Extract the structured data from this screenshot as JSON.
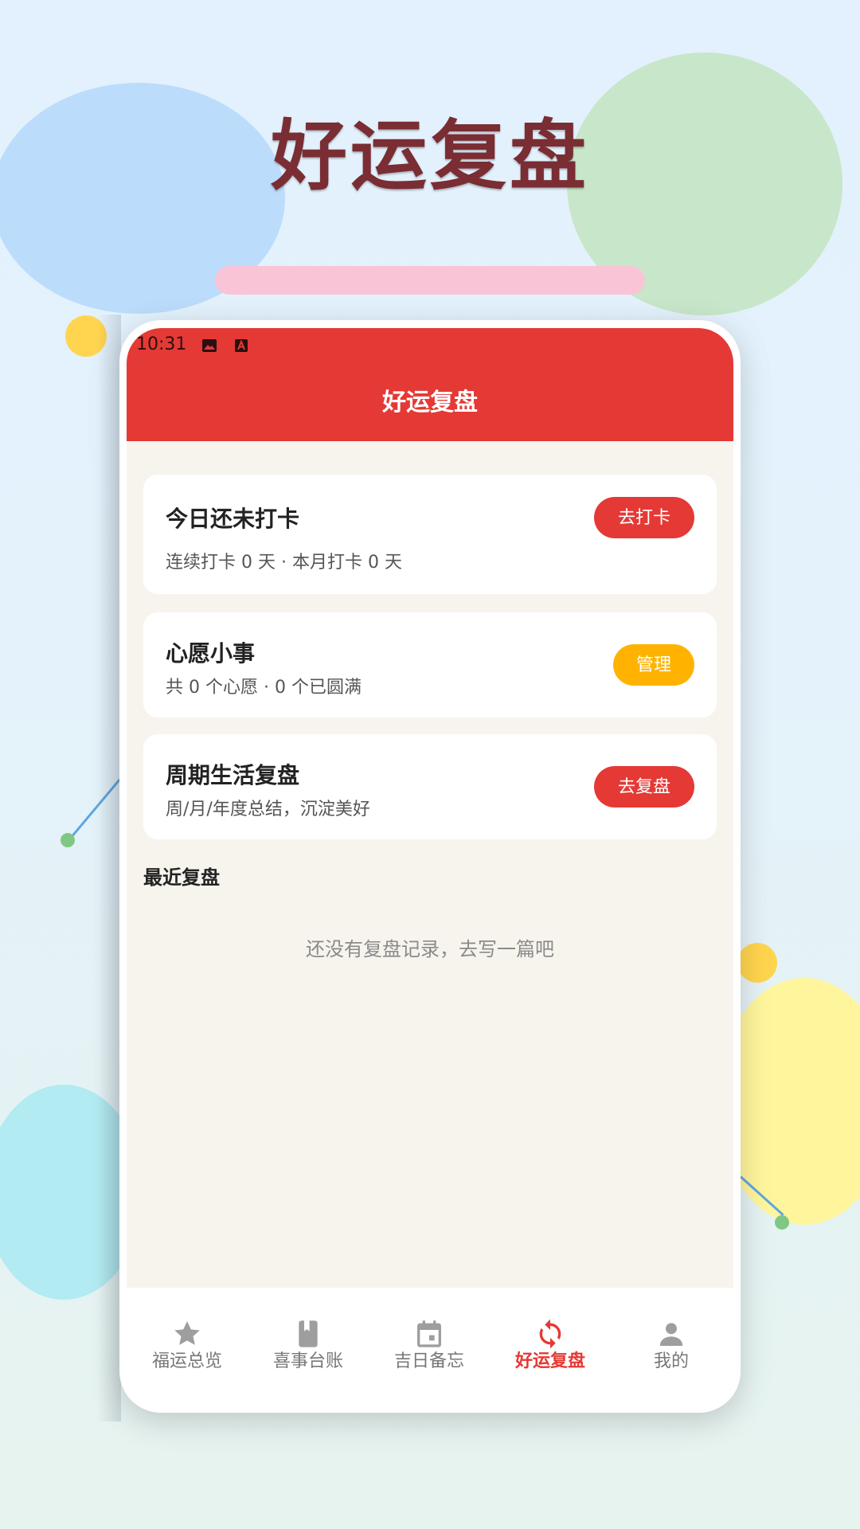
{
  "poster": {
    "title": "好运复盘"
  },
  "status_bar": {
    "time": "10:31"
  },
  "app_bar": {
    "title": "好运复盘"
  },
  "cards": {
    "checkin": {
      "title": "今日还未打卡",
      "subtitle": "连续打卡 0 天 · 本月打卡 0 天",
      "button": "去打卡"
    },
    "wishes": {
      "title": "心愿小事",
      "subtitle": "共 0 个心愿 · 0 个已圆满",
      "button": "管理"
    },
    "review": {
      "title": "周期生活复盘",
      "subtitle": "周/月/年度总结，沉淀美好",
      "button": "去复盘"
    }
  },
  "recent": {
    "title": "最近复盘",
    "empty_text": "还没有复盘记录，去写一篇吧"
  },
  "tabs": [
    {
      "label": "福运总览",
      "icon": "star-icon",
      "active": false
    },
    {
      "label": "喜事台账",
      "icon": "book-icon",
      "active": false
    },
    {
      "label": "吉日备忘",
      "icon": "calendar-icon",
      "active": false
    },
    {
      "label": "好运复盘",
      "icon": "sync-icon",
      "active": true
    },
    {
      "label": "我的",
      "icon": "person-icon",
      "active": false
    }
  ],
  "colors": {
    "primary": "#e53935",
    "accent": "#ffb300",
    "background": "#f7f4ee",
    "inactive": "#9e9e9e"
  }
}
